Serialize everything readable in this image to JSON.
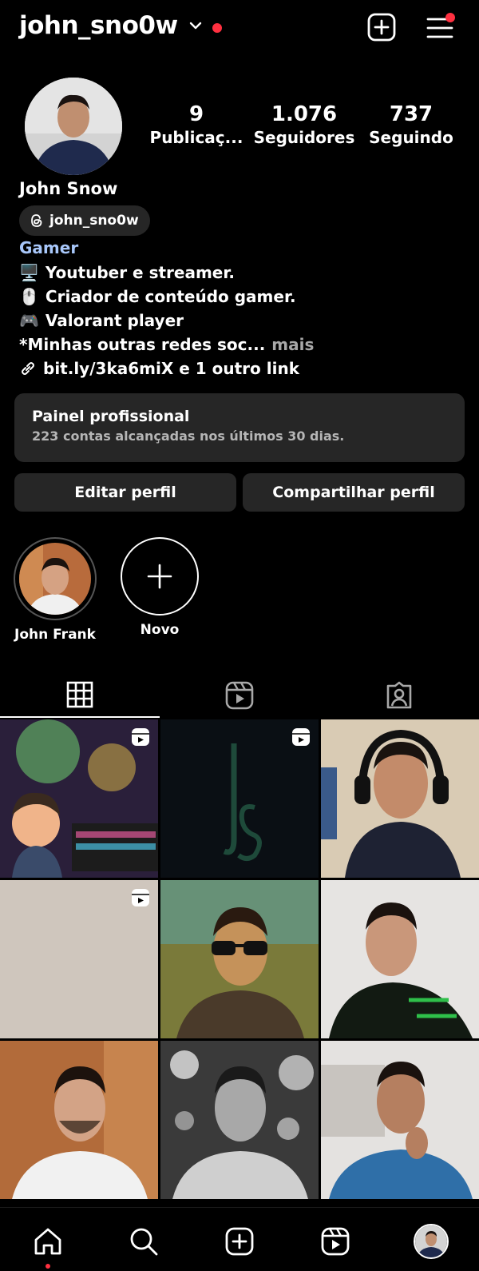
{
  "header": {
    "username": "john_sno0w",
    "icons": [
      "chevron-down-icon",
      "create-icon",
      "menu-icon"
    ]
  },
  "profile": {
    "stats": [
      {
        "value": "9",
        "label": "Publicaç..."
      },
      {
        "value": "1.076",
        "label": "Seguidores"
      },
      {
        "value": "737",
        "label": "Seguindo"
      }
    ],
    "full_name": "John Snow",
    "threads_handle": "john_sno0w",
    "category": "Gamer",
    "bio_lines": [
      {
        "emoji": "🖥️",
        "text": "Youtuber e streamer."
      },
      {
        "emoji": "🖱️",
        "text": "Criador de conteúdo gamer."
      },
      {
        "emoji": "🎮",
        "text": "Valorant player"
      }
    ],
    "bio_truncated": "*Minhas outras redes soc...",
    "bio_more": "mais",
    "link_text": "bit.ly/3ka6miX e 1 outro link"
  },
  "panel": {
    "title": "Painel profissional",
    "subtitle": "223 contas alcançadas nos últimos 30 dias."
  },
  "buttons": {
    "edit": "Editar perfil",
    "share": "Compartilhar perfil"
  },
  "highlights": [
    {
      "label": "John Frank"
    },
    {
      "label": "Novo"
    }
  ],
  "tabs": [
    "grid-icon",
    "reels-icon",
    "tagged-icon"
  ],
  "grid_posts": [
    {
      "type": "reel",
      "desc": "gamer setup"
    },
    {
      "type": "reel",
      "desc": "logo"
    },
    {
      "type": "photo",
      "desc": "selfie headset"
    },
    {
      "type": "reel",
      "desc": "blank"
    },
    {
      "type": "photo",
      "desc": "sunglasses art"
    },
    {
      "type": "photo",
      "desc": "green jersey"
    },
    {
      "type": "photo",
      "desc": "white shirt"
    },
    {
      "type": "photo",
      "desc": "bw portrait"
    },
    {
      "type": "photo",
      "desc": "blue shirt"
    }
  ],
  "nav": [
    "home-icon",
    "search-icon",
    "create-icon",
    "reels-icon",
    "profile-avatar"
  ],
  "colors": {
    "accent_red": "#ff3040",
    "category": "#a8c7fa",
    "surface": "#262626"
  }
}
